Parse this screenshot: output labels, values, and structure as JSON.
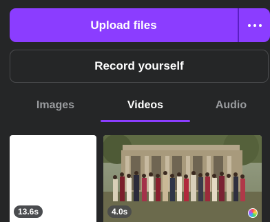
{
  "upload": {
    "label": "Upload files",
    "more_icon": "more-horizontal-icon"
  },
  "record": {
    "label": "Record yourself"
  },
  "tabs": [
    {
      "label": "Images",
      "active": false
    },
    {
      "label": "Videos",
      "active": true
    },
    {
      "label": "Audio",
      "active": false
    }
  ],
  "videos": [
    {
      "duration": "13.6s"
    },
    {
      "duration": "4.0s"
    }
  ],
  "colors": {
    "accent": "#8b3dff",
    "background": "#252627"
  }
}
